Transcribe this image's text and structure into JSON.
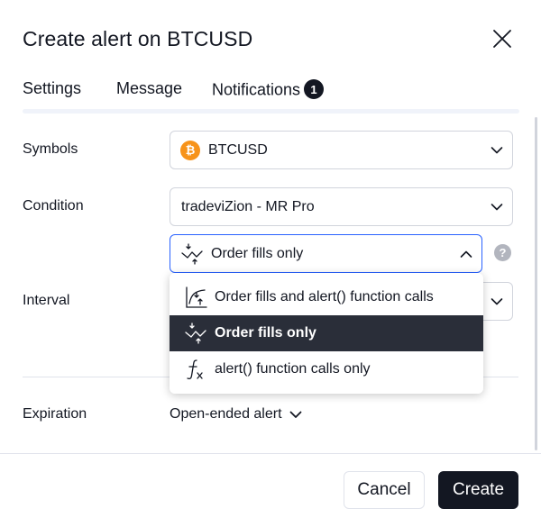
{
  "dialog": {
    "title": "Create alert on BTCUSD"
  },
  "tabs": [
    {
      "label": "Settings",
      "active": true
    },
    {
      "label": "Message",
      "active": false
    },
    {
      "label": "Notifications",
      "active": false,
      "badge": "1"
    }
  ],
  "form": {
    "symbols": {
      "label": "Symbols",
      "value": "BTCUSD",
      "icon_glyph": "₿"
    },
    "condition": {
      "label": "Condition",
      "value": "tradeviZion - MR Pro"
    },
    "trigger": {
      "value": "Order fills only",
      "help_glyph": "?"
    },
    "interval": {
      "label": "Interval"
    },
    "expiration": {
      "label": "Expiration",
      "value": "Open-ended alert"
    }
  },
  "dropdown": {
    "options": [
      {
        "label": "Order fills and alert() function calls",
        "icon": "order-fills-alerts-icon",
        "selected": false
      },
      {
        "label": "Order fills only",
        "icon": "order-fills-icon",
        "selected": true
      },
      {
        "label": "alert() function calls only",
        "icon": "function-icon",
        "selected": false
      }
    ]
  },
  "footer": {
    "cancel_label": "Cancel",
    "create_label": "Create"
  },
  "colors": {
    "accent": "#2962ff",
    "dark": "#131722",
    "bitcoin": "#f7931a",
    "selected_bg": "#2a2e39"
  }
}
